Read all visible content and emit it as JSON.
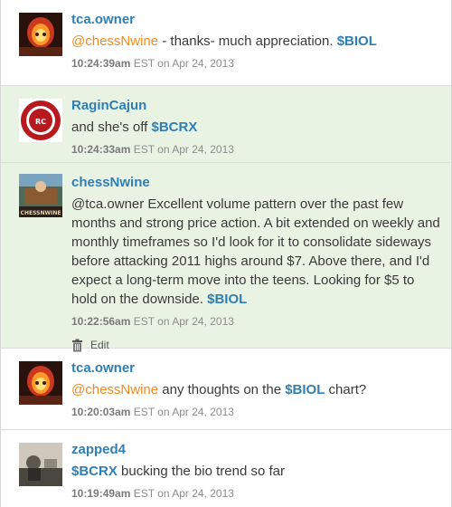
{
  "messages": [
    {
      "user": "tca.owner",
      "mention": "@chessNwine",
      "text": " - thanks- much appreciation. ",
      "ticker": "$BIOL",
      "time": "10:24:39am",
      "date": " EST on Apr 24, 2013",
      "avatar": "ghost-rider-avatar"
    },
    {
      "user": "RaginCajun",
      "text": "and she's off ",
      "ticker": "$BCRX",
      "time": "10:24:33am",
      "date": " EST on Apr 24, 2013",
      "avatar": "ragin-cajuns-logo"
    },
    {
      "user": "chessNwine",
      "text": "@tca.owner Excellent volume pattern over the past few months and strong price action. A bit extended on weekly and monthly timeframes so I'd look for it to consolidate sideways before attacking 2011 highs around $7. Above there, and I'd expect a long-term move into the teens. Looking for $5 to hold on the downside. ",
      "ticker": "$BIOL",
      "time": "10:22:56am",
      "date": " EST on Apr 24, 2013",
      "edit_label": "Edit",
      "avatar": "chessnwine-avatar"
    },
    {
      "user": "tca.owner",
      "mention": "@chessNwine",
      "text": " any thoughts on the ",
      "ticker": "$BIOL",
      "text2": " chart?",
      "time": "10:20:03am",
      "date": " EST on Apr 24, 2013",
      "avatar": "ghost-rider-avatar"
    },
    {
      "user": "zapped4",
      "ticker": "$BCRX",
      "text": " bucking the bio trend so far",
      "time": "10:19:49am",
      "date": " EST on Apr 24, 2013",
      "avatar": "zapped4-avatar"
    }
  ],
  "colors": {
    "highlight_bg": "#e8f3e4",
    "username": "#2f7fb4",
    "mention": "#f28a1e"
  }
}
